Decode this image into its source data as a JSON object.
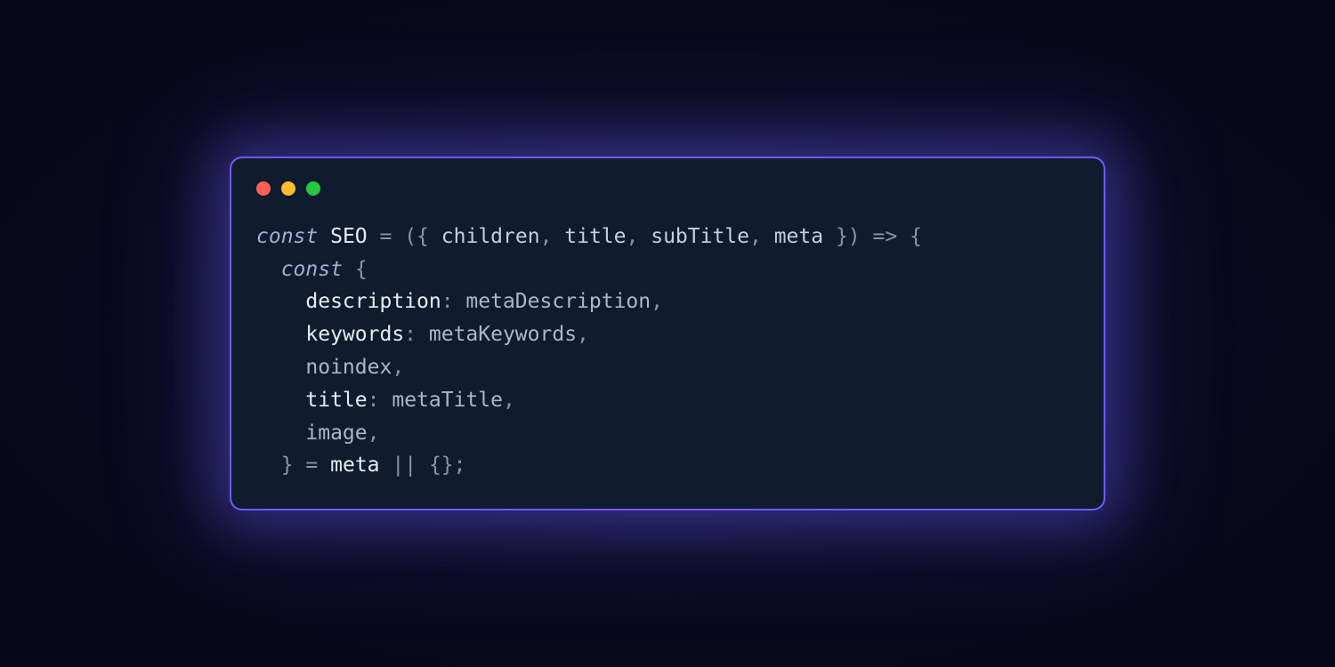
{
  "window": {
    "traffic_lights": {
      "red": "close",
      "yellow": "minimize",
      "green": "zoom"
    }
  },
  "code": {
    "lines": [
      {
        "indent": 0,
        "tokens": [
          {
            "cls": "tok-keyword",
            "t": "const"
          },
          {
            "cls": "",
            "t": " "
          },
          {
            "cls": "tok-ident",
            "t": "SEO"
          },
          {
            "cls": "",
            "t": " "
          },
          {
            "cls": "tok-punc",
            "t": "="
          },
          {
            "cls": "",
            "t": " "
          },
          {
            "cls": "tok-punc",
            "t": "({ "
          },
          {
            "cls": "tok-param",
            "t": "children"
          },
          {
            "cls": "tok-punc",
            "t": ", "
          },
          {
            "cls": "tok-param",
            "t": "title"
          },
          {
            "cls": "tok-punc",
            "t": ", "
          },
          {
            "cls": "tok-param",
            "t": "subTitle"
          },
          {
            "cls": "tok-punc",
            "t": ", "
          },
          {
            "cls": "tok-param",
            "t": "meta"
          },
          {
            "cls": "tok-punc",
            "t": " })"
          },
          {
            "cls": "",
            "t": " "
          },
          {
            "cls": "tok-punc",
            "t": "=>"
          },
          {
            "cls": "",
            "t": " "
          },
          {
            "cls": "tok-punc",
            "t": "{"
          }
        ]
      },
      {
        "indent": 1,
        "tokens": [
          {
            "cls": "tok-keyword",
            "t": "const"
          },
          {
            "cls": "",
            "t": " "
          },
          {
            "cls": "tok-punc",
            "t": "{"
          }
        ]
      },
      {
        "indent": 2,
        "tokens": [
          {
            "cls": "tok-prop",
            "t": "description"
          },
          {
            "cls": "tok-punc",
            "t": ": "
          },
          {
            "cls": "tok-val",
            "t": "metaDescription"
          },
          {
            "cls": "tok-punc",
            "t": ","
          }
        ]
      },
      {
        "indent": 2,
        "tokens": [
          {
            "cls": "tok-prop",
            "t": "keywords"
          },
          {
            "cls": "tok-punc",
            "t": ": "
          },
          {
            "cls": "tok-val",
            "t": "metaKeywords"
          },
          {
            "cls": "tok-punc",
            "t": ","
          }
        ]
      },
      {
        "indent": 2,
        "tokens": [
          {
            "cls": "tok-val",
            "t": "noindex"
          },
          {
            "cls": "tok-punc",
            "t": ","
          }
        ]
      },
      {
        "indent": 2,
        "tokens": [
          {
            "cls": "tok-prop",
            "t": "title"
          },
          {
            "cls": "tok-punc",
            "t": ": "
          },
          {
            "cls": "tok-val",
            "t": "metaTitle"
          },
          {
            "cls": "tok-punc",
            "t": ","
          }
        ]
      },
      {
        "indent": 2,
        "tokens": [
          {
            "cls": "tok-val",
            "t": "image"
          },
          {
            "cls": "tok-punc",
            "t": ","
          }
        ]
      },
      {
        "indent": 1,
        "tokens": [
          {
            "cls": "tok-punc",
            "t": "}"
          },
          {
            "cls": "",
            "t": " "
          },
          {
            "cls": "tok-punc",
            "t": "="
          },
          {
            "cls": "",
            "t": " "
          },
          {
            "cls": "tok-ident",
            "t": "meta"
          },
          {
            "cls": "",
            "t": " "
          },
          {
            "cls": "tok-punc",
            "t": "||"
          },
          {
            "cls": "",
            "t": " "
          },
          {
            "cls": "tok-punc",
            "t": "{};"
          }
        ]
      }
    ]
  }
}
